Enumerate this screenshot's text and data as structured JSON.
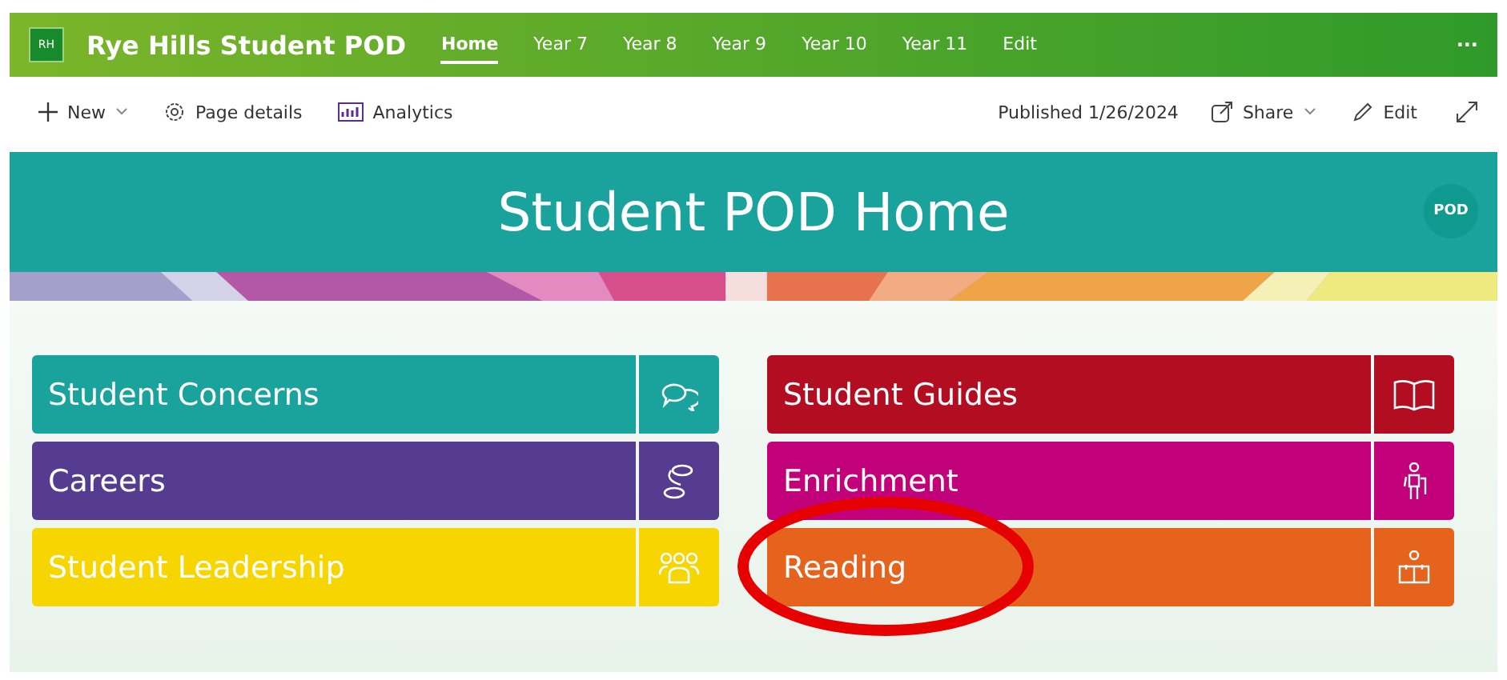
{
  "site": {
    "logo": "RH",
    "title": "Rye Hills Student POD",
    "more": "···"
  },
  "nav": [
    {
      "label": "Home",
      "selected": true
    },
    {
      "label": "Year 7",
      "selected": false
    },
    {
      "label": "Year 8",
      "selected": false
    },
    {
      "label": "Year 9",
      "selected": false
    },
    {
      "label": "Year 10",
      "selected": false
    },
    {
      "label": "Year 11",
      "selected": false
    },
    {
      "label": "Edit",
      "selected": false
    }
  ],
  "command_bar": {
    "new": "New",
    "page_details": "Page details",
    "analytics": "Analytics",
    "published": "Published 1/26/2024",
    "share": "Share",
    "edit": "Edit"
  },
  "banner": {
    "title": "Student POD Home",
    "logo": "POD"
  },
  "tiles_left": [
    {
      "label": "Student Concerns",
      "color": "#1aa39c"
    },
    {
      "label": "Careers",
      "color": "#553c91"
    },
    {
      "label": "Student Leadership",
      "color": "#f7d500"
    }
  ],
  "tiles_right": [
    {
      "label": "Student Guides",
      "color": "#b30d22"
    },
    {
      "label": "Enrichment",
      "color": "#c2007a"
    },
    {
      "label": "Reading",
      "color": "#e6631e"
    }
  ]
}
